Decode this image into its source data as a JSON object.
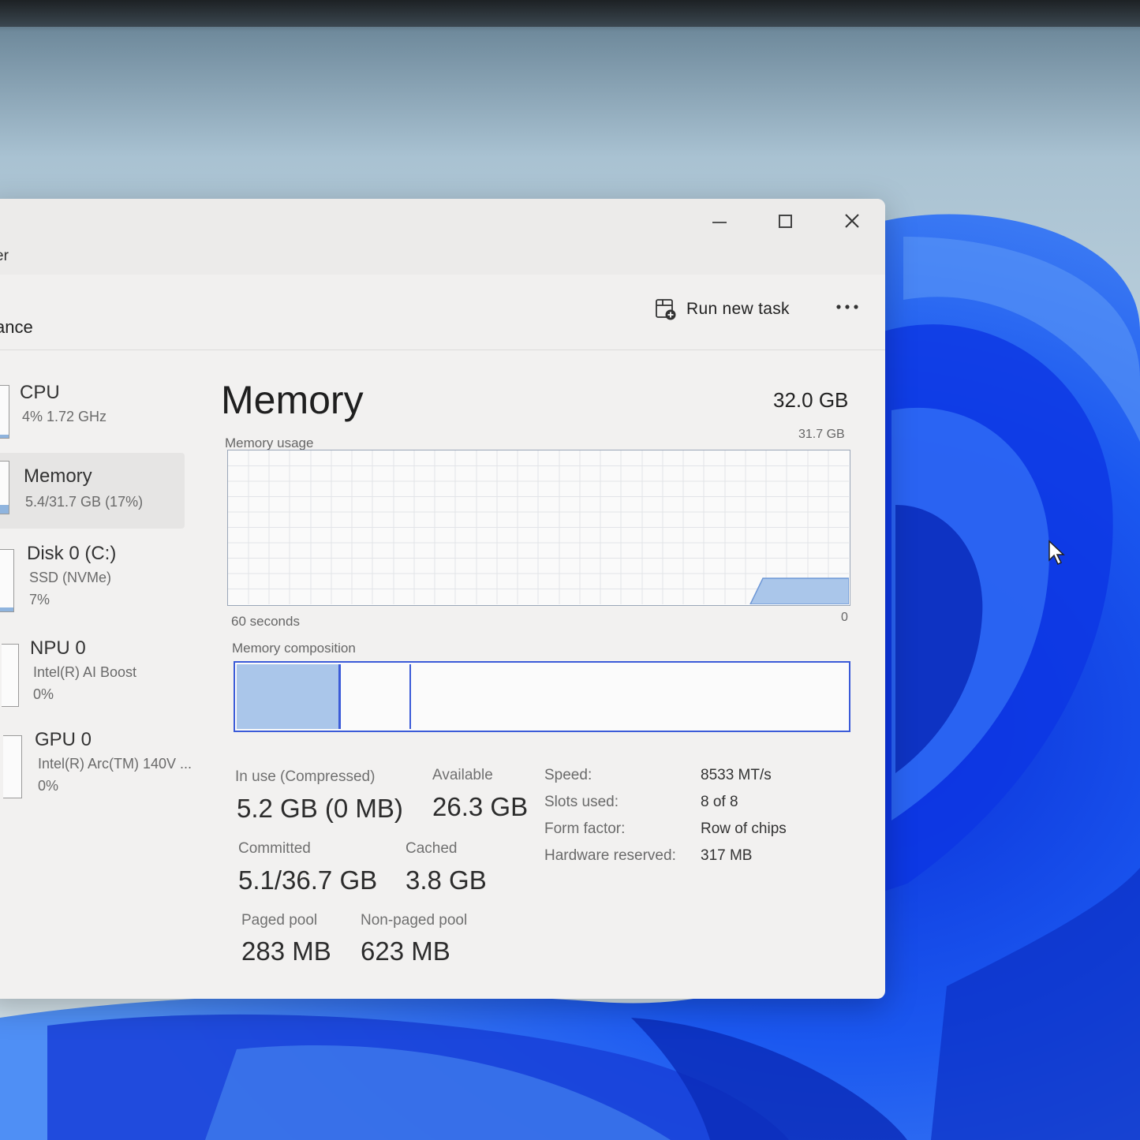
{
  "window": {
    "title_fragment": "er",
    "heading_fragment": "ance"
  },
  "toolbar": {
    "run_new_task": "Run new task",
    "more_icon": "ellipsis-icon"
  },
  "sidebar": {
    "items": [
      {
        "title": "CPU",
        "line1": "4%  1.72 GHz",
        "line2": "",
        "level": 0.04
      },
      {
        "title": "Memory",
        "line1": "5.4/31.7 GB (17%)",
        "line2": "",
        "level": 0.17,
        "selected": true
      },
      {
        "title": "Disk 0 (C:)",
        "line1": "SSD (NVMe)",
        "line2": "7%",
        "level": 0.07
      },
      {
        "title": "NPU 0",
        "line1": "Intel(R) AI Boost",
        "line2": "0%",
        "level": 0
      },
      {
        "title": "GPU 0",
        "line1": "Intel(R) Arc(TM) 140V ...",
        "line2": "0%",
        "level": 0
      }
    ]
  },
  "main": {
    "title": "Memory",
    "total": "32.0 GB",
    "usage_label": "Memory usage",
    "usage_max": "31.7 GB",
    "axis_left": "60 seconds",
    "axis_right": "0",
    "composition_label": "Memory composition",
    "composition": {
      "in_use_fraction": 0.17,
      "modified_fraction": 0.115
    }
  },
  "stats": {
    "in_use_label": "In use (Compressed)",
    "in_use_value": "5.2 GB (0 MB)",
    "available_label": "Available",
    "available_value": "26.3 GB",
    "committed_label": "Committed",
    "committed_value": "5.1/36.7 GB",
    "cached_label": "Cached",
    "cached_value": "3.8 GB",
    "paged_label": "Paged pool",
    "paged_value": "283 MB",
    "nonpaged_label": "Non-paged pool",
    "nonpaged_value": "623 MB"
  },
  "specs": {
    "speed_label": "Speed:",
    "speed_value": "8533 MT/s",
    "slots_label": "Slots used:",
    "slots_value": "8 of 8",
    "form_label": "Form factor:",
    "form_value": "Row of chips",
    "hw_label": "Hardware reserved:",
    "hw_value": "317 MB"
  },
  "colors": {
    "accent": "#3b5bd8",
    "graph_fill": "#aac6ea",
    "wallpaper_blue": "#1f4fe0"
  }
}
